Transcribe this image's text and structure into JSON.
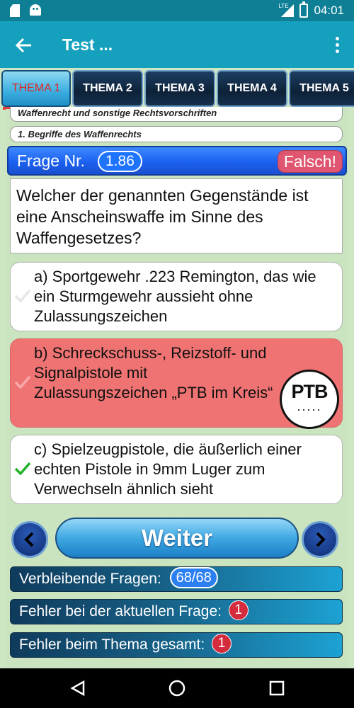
{
  "status_bar": {
    "time": "04:01",
    "network": "LTE"
  },
  "app_bar": {
    "title": "Test ..."
  },
  "tabs": [
    {
      "label": "THEMA 1",
      "active": true
    },
    {
      "label": "THEMA 2",
      "active": false
    },
    {
      "label": "THEMA 3",
      "active": false
    },
    {
      "label": "THEMA 4",
      "active": false
    },
    {
      "label": "THEMA 5",
      "active": false
    }
  ],
  "breadcrumb": {
    "section": "Waffenrecht und sonstige Rechtsvorschriften",
    "topic": "1. Begriffe des Waffenrechts"
  },
  "question": {
    "label": "Frage Nr.",
    "number": "1.86",
    "verdict": "Falsch!",
    "text": "Welcher der genannten Gegenstände ist eine Anscheinswaffe im Sinne des Waffengesetzes?"
  },
  "answers": [
    {
      "text": "a) Sportgewehr .223 Remington, das wie ein Sturmgewehr aussieht ohne Zulassungszeichen",
      "state": "neutral"
    },
    {
      "text": "b) Schreckschuss-, Reizstoff- und Signalpistole mit Zulassungszeichen „PTB im Kreis“",
      "state": "wrong",
      "badge": {
        "text": "PTB",
        "dots": "....."
      }
    },
    {
      "text": "c) Spielzeugpistole, die äußerlich einer echten Pistole in 9mm Luger zum Verwechseln ähnlich sieht",
      "state": "correct"
    }
  ],
  "controls": {
    "next_label": "Weiter"
  },
  "stats": {
    "remaining_label": "Verbleibende Fragen:",
    "remaining_value": "68/68",
    "current_errors_label": "Fehler bei der aktuellen Frage:",
    "current_errors_value": "1",
    "topic_errors_label": "Fehler beim Thema gesamt:",
    "topic_errors_value": "1"
  },
  "colors": {
    "app_bar": "#15a1bd",
    "background": "#cfe6c4",
    "wrong_answer": "#f07373",
    "correct_check": "#22b32a",
    "question_header": "#1b61f0"
  }
}
